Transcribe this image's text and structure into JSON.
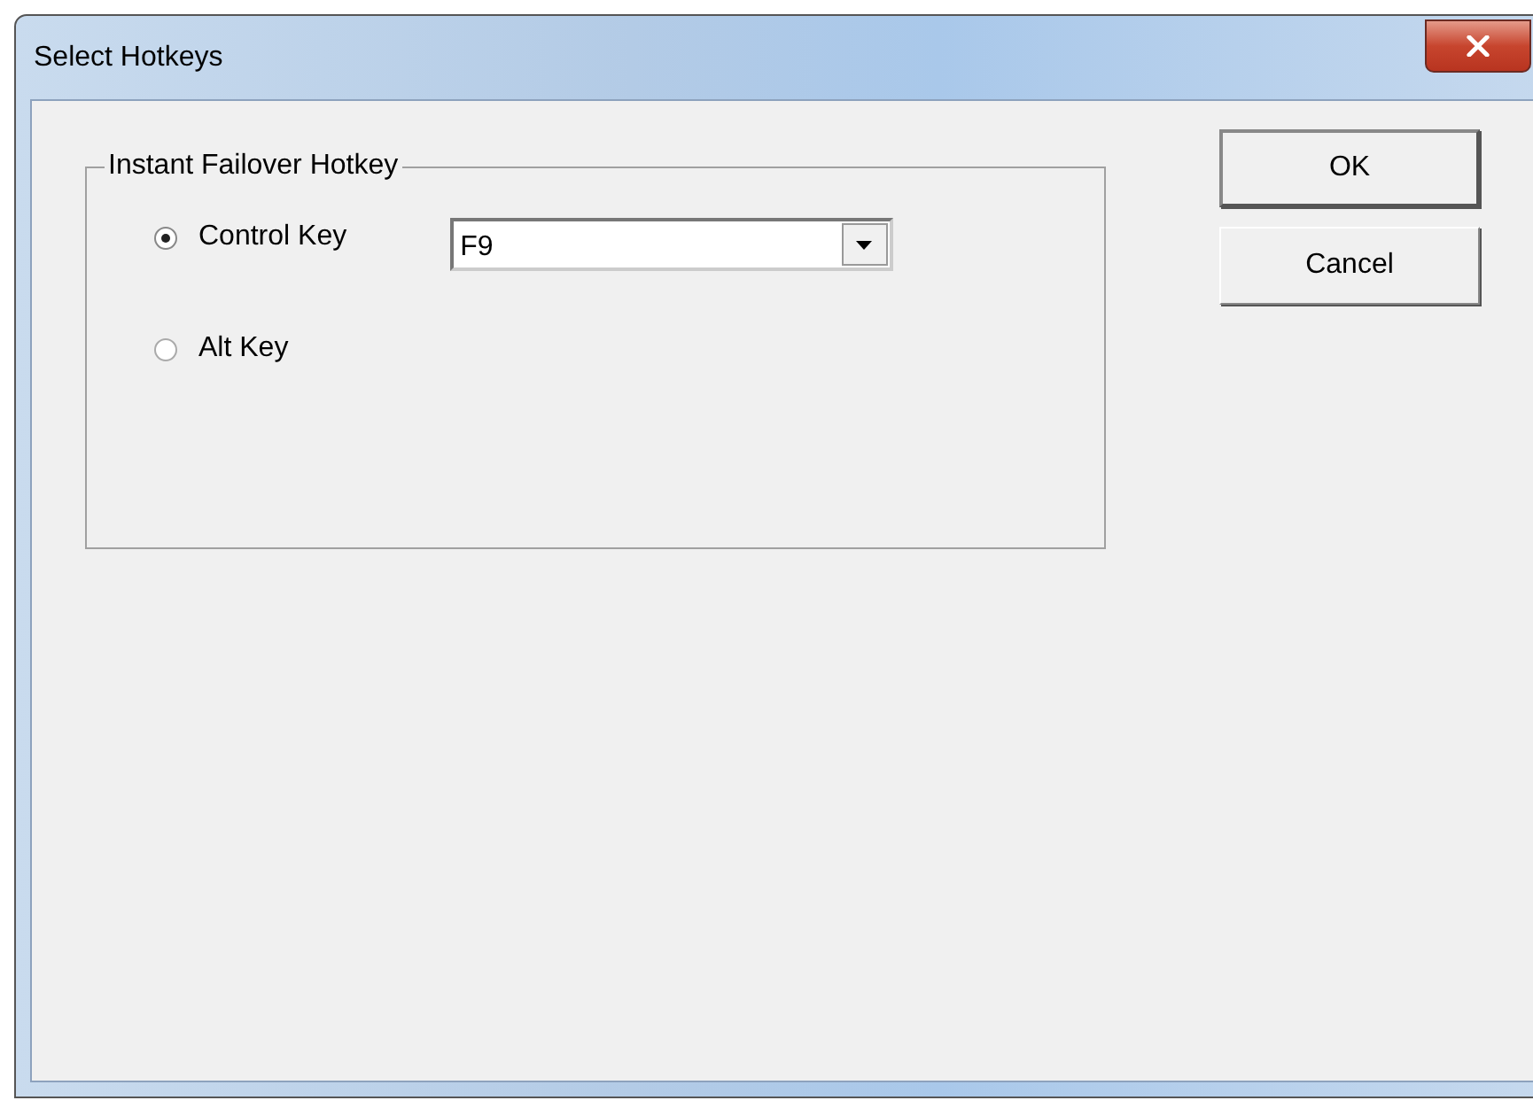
{
  "window": {
    "title": "Select Hotkeys"
  },
  "group": {
    "title": "Instant Failover Hotkey",
    "options": [
      {
        "label": "Control Key",
        "selected": true
      },
      {
        "label": "Alt Key",
        "selected": false
      }
    ],
    "dropdown": {
      "value": "F9"
    }
  },
  "buttons": [
    {
      "label": "OK",
      "default": true
    },
    {
      "label": "Cancel",
      "default": false
    }
  ]
}
